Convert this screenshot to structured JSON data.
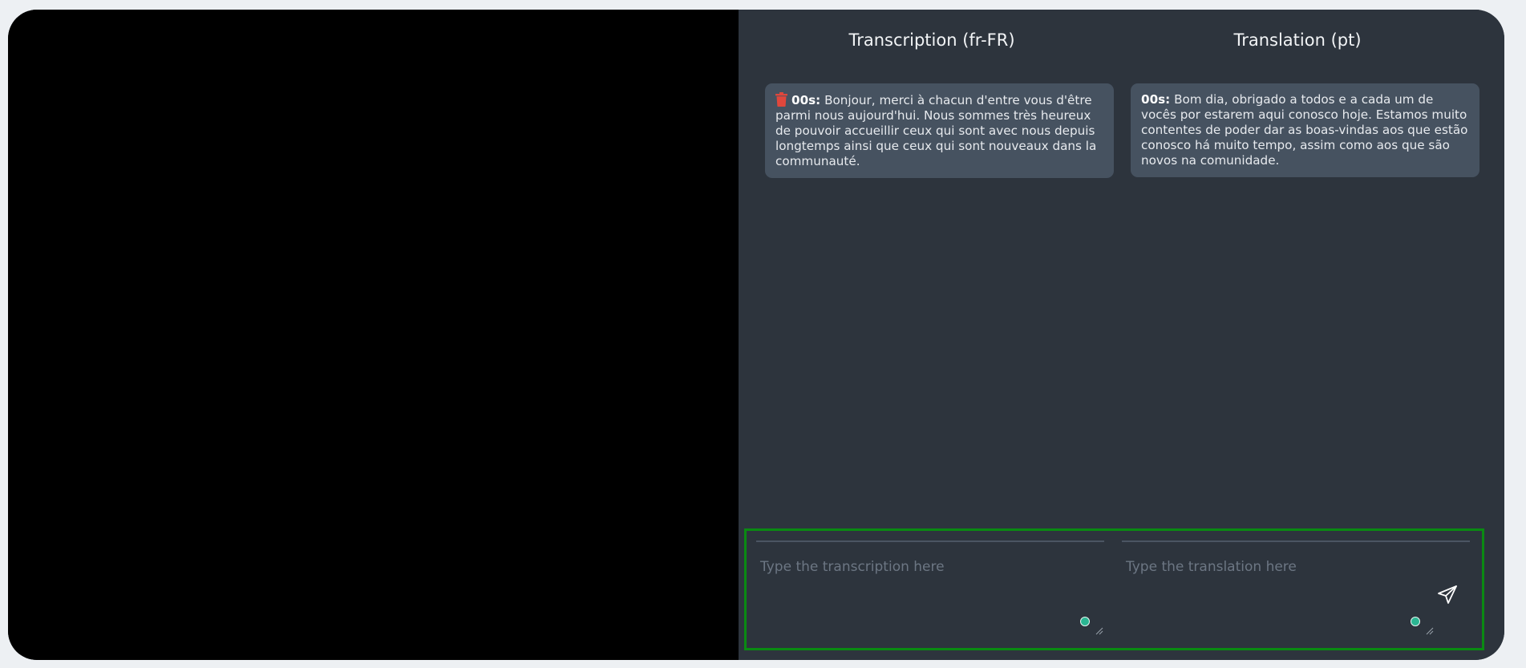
{
  "transcription": {
    "title": "Transcription (fr-FR)",
    "entries": [
      {
        "timestamp": "00s:",
        "text": "Bonjour, merci à chacun d'entre vous d'être parmi nous aujourd'hui. Nous sommes très heureux de pouvoir accueillir ceux qui sont avec nous depuis longtemps ainsi que ceux qui sont nouveaux dans la communauté.",
        "delete_icon": "trash-icon"
      }
    ],
    "input_placeholder": "Type the transcription here"
  },
  "translation": {
    "title": "Translation (pt)",
    "entries": [
      {
        "timestamp": "00s:",
        "text": "Bom dia, obrigado a todos e a cada um de vocês por estarem aqui conosco hoje. Estamos muito contentes de poder dar as boas-vindas aos que estão conosco há muito tempo, assim como aos que são novos na comunidade."
      }
    ],
    "input_placeholder": "Type the translation here"
  },
  "send_icon": "send-icon",
  "colors": {
    "panel_bg": "#2d343d",
    "card_bg": "#465260",
    "trash": "#e0473c",
    "status_dot": "#2bb592",
    "highlight_border": "#0a8a12"
  }
}
